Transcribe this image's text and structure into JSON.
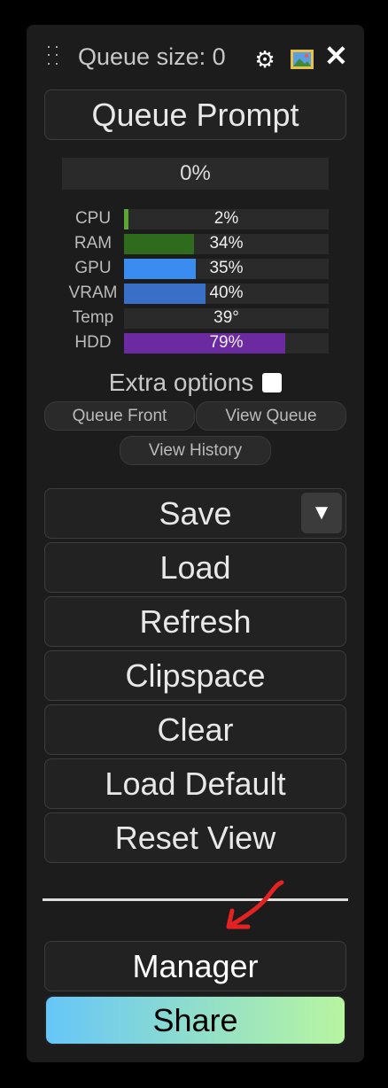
{
  "header": {
    "queue_size_label": "Queue size: 0"
  },
  "queue_prompt_label": "Queue Prompt",
  "progress": {
    "percent": 0,
    "text": "0%"
  },
  "stats": [
    {
      "label": "CPU",
      "value_text": "2%",
      "fraction": 0.02,
      "color": "#5aa832"
    },
    {
      "label": "RAM",
      "value_text": "34%",
      "fraction": 0.34,
      "color": "#2e6b1c"
    },
    {
      "label": "GPU",
      "value_text": "35%",
      "fraction": 0.35,
      "color": "#3b8cf0"
    },
    {
      "label": "VRAM",
      "value_text": "40%",
      "fraction": 0.4,
      "color": "#3a6fc8"
    },
    {
      "label": "Temp",
      "value_text": "39°",
      "fraction": 0.0,
      "color": "#2a2a2a"
    },
    {
      "label": "HDD",
      "value_text": "79%",
      "fraction": 0.79,
      "color": "#6b2aa0"
    }
  ],
  "extra_options_label": "Extra options",
  "extra_options_checked": false,
  "queue_front_label": "Queue Front",
  "view_queue_label": "View Queue",
  "view_history_label": "View History",
  "menu": {
    "save": "Save",
    "save_dropdown_glyph": "▼",
    "load": "Load",
    "refresh": "Refresh",
    "clipspace": "Clipspace",
    "clear": "Clear",
    "load_default": "Load Default",
    "reset_view": "Reset View"
  },
  "manager_label": "Manager",
  "share_label": "Share",
  "icons": {
    "settings": "gear-icon",
    "image": "image-icon",
    "close": "close-icon",
    "drag": "drag-handle-icon"
  },
  "colors": {
    "panel_bg": "#1c1c1c",
    "share_gradient_start": "#66c6f8",
    "share_gradient_end": "#b8f5a0",
    "annotation_arrow": "#e52222"
  }
}
